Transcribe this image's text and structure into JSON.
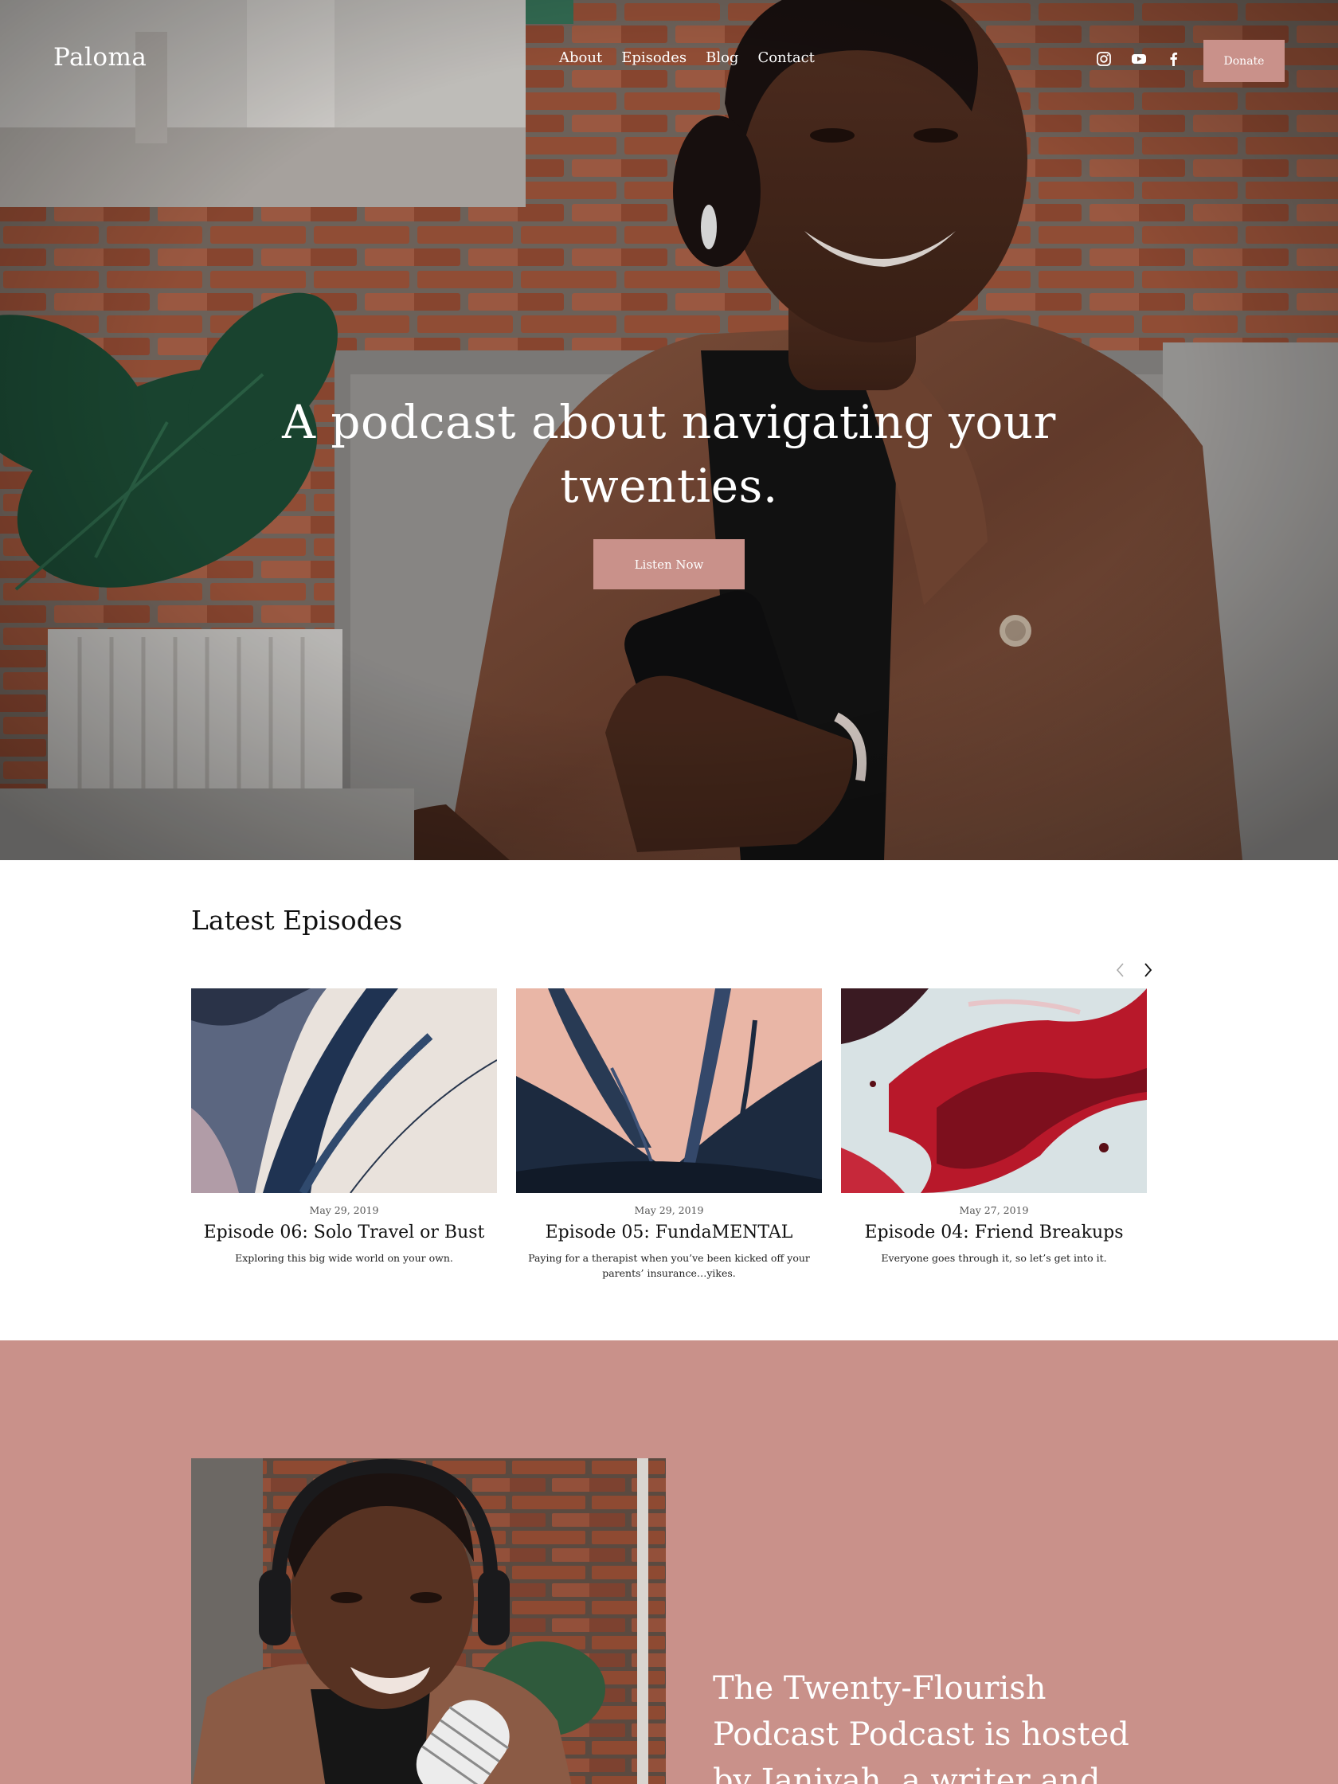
{
  "header": {
    "logo": "Paloma",
    "nav": [
      "About",
      "Episodes",
      "Blog",
      "Contact"
    ],
    "social": [
      "instagram-icon",
      "youtube-icon",
      "facebook-icon"
    ],
    "donate_label": "Donate"
  },
  "hero": {
    "title": "A podcast about navigating your twenties.",
    "cta_label": "Listen Now"
  },
  "episodes": {
    "title": "Latest Episodes",
    "items": [
      {
        "date": "May 29, 2019",
        "title": "Episode 06: Solo Travel or Bust",
        "description": "Exploring this big wide world on your own."
      },
      {
        "date": "May 29, 2019",
        "title": "Episode 05: FundaMENTAL",
        "description": "Paying for a therapist when you’ve been kicked off your parents’ insurance…yikes."
      },
      {
        "date": "May 27, 2019",
        "title": "Episode 04: Friend Breakups",
        "description": "Everyone goes through it, so let’s get into it."
      }
    ]
  },
  "about": {
    "text": "The Twenty-Flourish Podcast Podcast is hosted by Janiyah, a writer and aspiring adult."
  },
  "colors": {
    "accent": "#c9918a",
    "text_dark": "#111111",
    "white": "#ffffff"
  }
}
